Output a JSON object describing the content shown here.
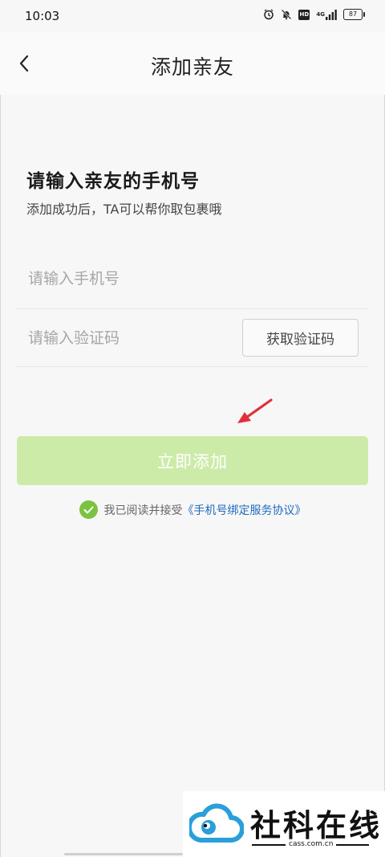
{
  "status_bar": {
    "time": "10:03",
    "network": "4G",
    "battery": "87",
    "hd_badge": "HD"
  },
  "nav": {
    "title": "添加亲友"
  },
  "form": {
    "heading": "请输入亲友的手机号",
    "subheading": "添加成功后，TA可以帮你取包裹哦",
    "phone_placeholder": "请输入手机号",
    "phone_value": "",
    "code_placeholder": "请输入验证码",
    "code_value": "",
    "get_code_label": "获取验证码",
    "submit_label": "立即添加"
  },
  "agreement": {
    "checked": true,
    "prefix": "我已阅读并接受",
    "link": "《手机号绑定服务协议》"
  },
  "watermark": {
    "text": "社科在线",
    "sub": "cass.com.cn"
  },
  "colors": {
    "submit_bg": "#cdeba8",
    "check": "#7bc241",
    "link": "#1f6bbf",
    "arrow": "#e0303a"
  }
}
